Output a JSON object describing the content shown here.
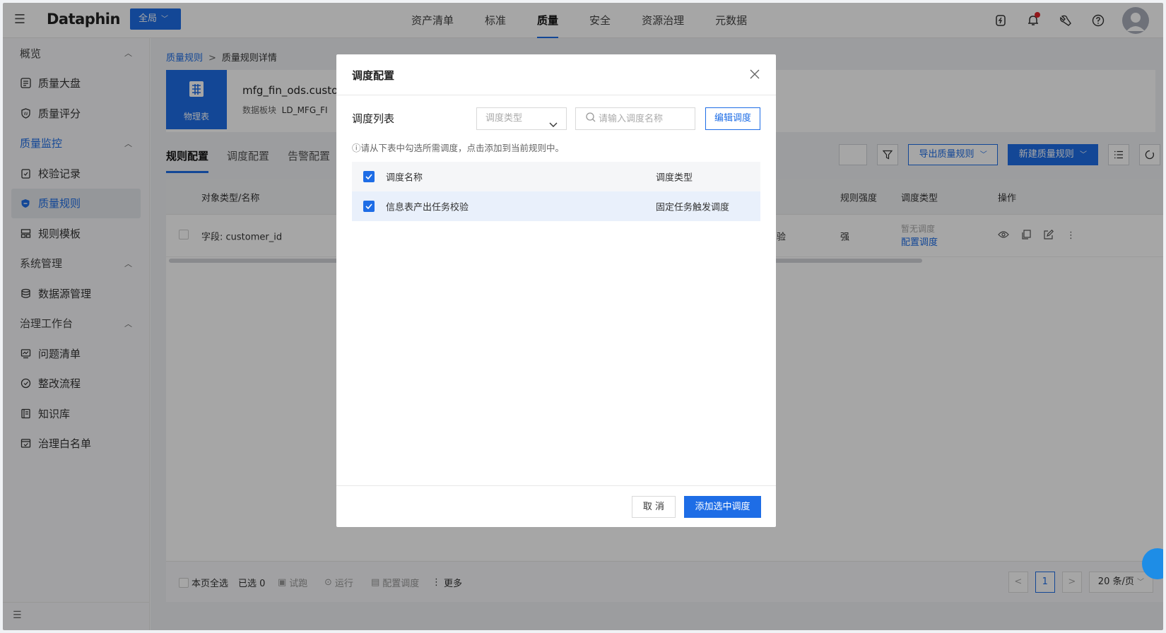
{
  "topbar": {
    "logo": "Dataphin",
    "scope": "全局",
    "nav": [
      "资产清单",
      "标准",
      "质量",
      "安全",
      "资源治理",
      "元数据"
    ],
    "active_nav": "质量",
    "icons": [
      "power-icon",
      "bell-icon",
      "wrench-icon",
      "help-icon",
      "avatar"
    ]
  },
  "sidebar": {
    "items": [
      {
        "label": "概览",
        "type": "group"
      },
      {
        "label": "质量大盘",
        "icon": "dashboard-icon"
      },
      {
        "label": "质量评分",
        "icon": "score-icon"
      },
      {
        "label": "质量监控",
        "type": "group"
      },
      {
        "label": "校验记录",
        "icon": "clipboard-icon"
      },
      {
        "label": "质量规则",
        "icon": "shield-icon"
      },
      {
        "label": "规则模板",
        "icon": "template-icon"
      },
      {
        "label": "系统管理",
        "type": "group"
      },
      {
        "label": "数据源管理",
        "icon": "database-icon"
      },
      {
        "label": "治理工作台",
        "type": "group"
      },
      {
        "label": "问题清单",
        "icon": "chart-icon"
      },
      {
        "label": "整改流程",
        "icon": "flow-icon"
      },
      {
        "label": "知识库",
        "icon": "book-icon"
      },
      {
        "label": "治理白名单",
        "icon": "whitelist-icon"
      }
    ]
  },
  "breadcrumb": {
    "link": "质量规则",
    "sep": ">",
    "current": "质量规则详情"
  },
  "object": {
    "type_label": "物理表",
    "name": "mfg_fin_ods.custom",
    "meta_label": "数据板块",
    "meta_value": "LD_MFG_FI"
  },
  "tabs": [
    "规则配置",
    "调度配置",
    "告警配置"
  ],
  "toolbar": {
    "export": "导出质量规则",
    "create": "新建质量规则"
  },
  "table": {
    "headers": {
      "object": "对象类型/名称",
      "strength": "规则强度",
      "schedule_type": "调度类型",
      "ops": "操作"
    },
    "row": {
      "object": "字段: customer_id",
      "partial": "验",
      "strength": "强",
      "schedule_none": "暂无调度",
      "schedule_link": "配置调度"
    }
  },
  "footer": {
    "select_all": "本页全选",
    "selected": "已选 0",
    "trial": "试跑",
    "run": "运行",
    "config": "配置调度",
    "more": "更多",
    "page": "1",
    "page_size": "20 条/页"
  },
  "modal": {
    "title": "调度配置",
    "section": "调度列表",
    "type_placeholder": "调度类型",
    "search_placeholder": "请输入调度名称",
    "edit_button": "编辑调度",
    "hint": "ⓘ请从下表中勾选所需调度，点击添加到当前规则中。",
    "columns": {
      "name": "调度名称",
      "type": "调度类型"
    },
    "rows": [
      {
        "name": "信息表产出任务校验",
        "type": "固定任务触发调度",
        "checked": true
      }
    ],
    "cancel": "取 消",
    "confirm": "添加选中调度"
  }
}
